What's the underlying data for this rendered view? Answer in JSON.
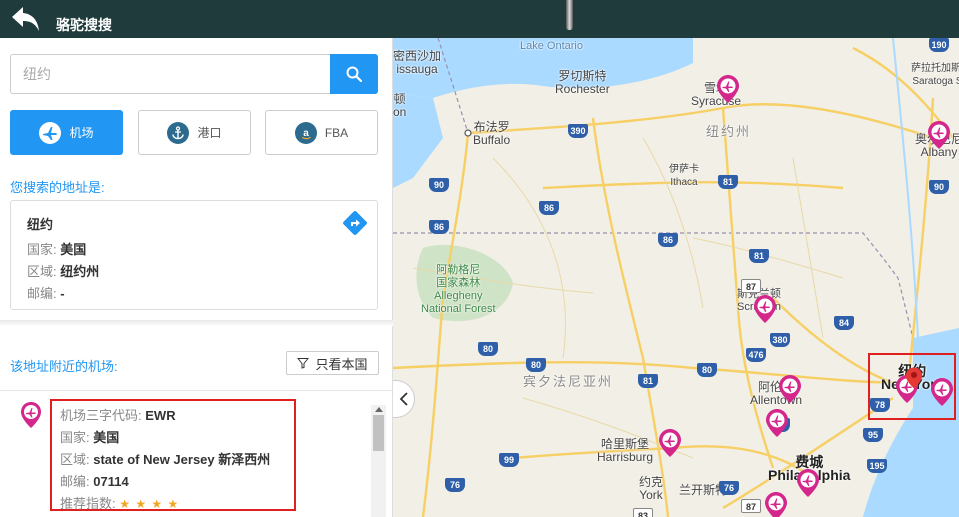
{
  "app": {
    "title": "骆驼搜搜"
  },
  "search": {
    "value": "",
    "placeholder": "纽约"
  },
  "tabs": [
    {
      "label": "机场",
      "icon": "airplane-icon",
      "active": true
    },
    {
      "label": "港口",
      "icon": "anchor-icon",
      "active": false
    },
    {
      "label": "FBA",
      "icon": "amazon-icon",
      "active": false
    }
  ],
  "address_section": {
    "heading": "您搜索的地址是:",
    "name": "纽约",
    "country_label": "国家:",
    "country": "美国",
    "region_label": "区域:",
    "region": "纽约州",
    "postal_label": "邮编:",
    "postal": "-"
  },
  "nearby": {
    "heading": "该地址附近的机场:",
    "filter_label": "只看本国",
    "results": [
      {
        "code_label": "机场三字代码:",
        "code": "EWR",
        "country_label": "国家:",
        "country": "美国",
        "region_label": "区域:",
        "region": "state of New Jersey 新泽西州",
        "postal_label": "邮编:",
        "postal": "07114",
        "rating_label": "推荐指数:",
        "rating": 4,
        "rating_stars": "★ ★ ★ ★"
      }
    ]
  },
  "map": {
    "labels": {
      "lake_ontario": "Lake Ontario",
      "mississauga_cn": "密西沙加",
      "mississauga_en": "issauga",
      "ham_cn": "顿",
      "ham_en": "on",
      "rochester_cn": "罗切斯特",
      "rochester_en": "Rochester",
      "syracuse_cn": "雪城",
      "syracuse_en": "Syracuse",
      "buffalo_cn": "布法罗",
      "buffalo_en": "Buffalo",
      "ny_state": "纽约州",
      "ithaca_cn": "伊萨卡",
      "ithaca_en": "Ithaca",
      "saratoga_cn": "萨拉托加斯普林斯",
      "saratoga_en": "Saratoga Springs",
      "albany_cn": "奥尔巴尼",
      "albany_en": "Albany",
      "forest_cn1": "阿勒格尼",
      "forest_cn2": "国家森林",
      "forest_en1": "Allegheny",
      "forest_en2": "National Forest",
      "scranton_cn": "斯克兰顿",
      "scranton_en": "Scranton",
      "pa_state": "宾夕法尼亚州",
      "allentown_cn": "阿伦敦",
      "allentown_en": "Allentown",
      "harrisburg_cn": "哈里斯堡",
      "harrisburg_en": "Harrisburg",
      "philadelphia_cn": "费城",
      "philadelphia_en": "Philadelphia",
      "york_cn": "约克",
      "york_en": "York",
      "lancaster_cn": "兰开斯特",
      "newyork_cn": "纽约",
      "newyork_en": "New York"
    },
    "shields": [
      "190",
      "90",
      "390",
      "81",
      "86",
      "86",
      "86",
      "81",
      "90",
      "380",
      "84",
      "476",
      "80",
      "80",
      "80",
      "81",
      "78",
      "78",
      "95",
      "99",
      "76",
      "76",
      "195",
      "83",
      "87",
      "87"
    ]
  }
}
